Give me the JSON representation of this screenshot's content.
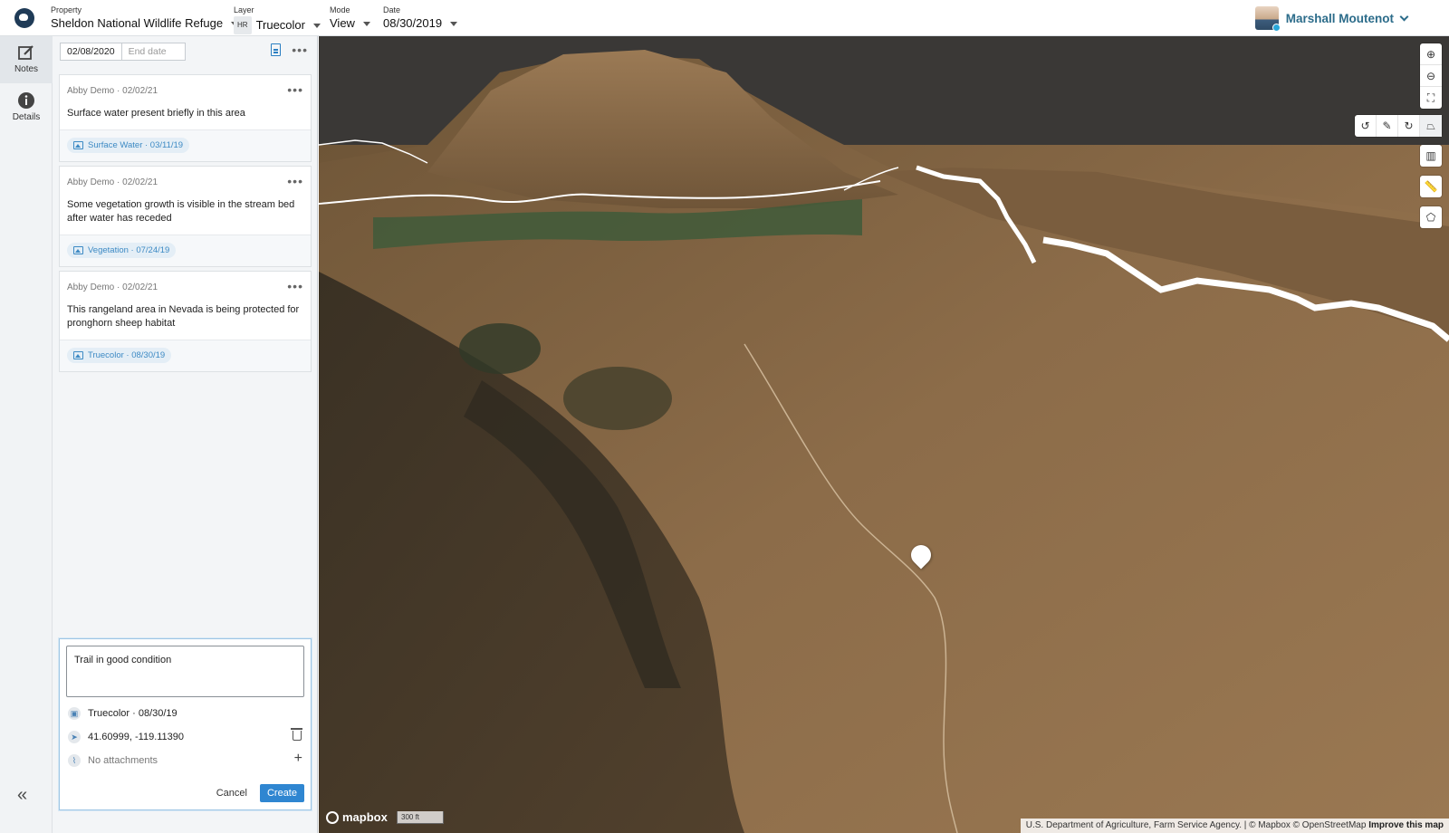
{
  "topbar": {
    "property": {
      "label": "Property",
      "value": "Sheldon National Wildlife Refuge"
    },
    "layer": {
      "label": "Layer",
      "badge": "HR",
      "value": "Truecolor"
    },
    "mode": {
      "label": "Mode",
      "value": "View"
    },
    "date": {
      "label": "Date",
      "value": "08/30/2019"
    },
    "user": {
      "name": "Marshall Moutenot"
    }
  },
  "rail": {
    "items": [
      {
        "label": "Notes",
        "icon": "edit-icon"
      },
      {
        "label": "Details",
        "icon": "info-icon"
      }
    ],
    "collapse_glyph": "«"
  },
  "panel": {
    "start_date": "02/08/2020",
    "end_date_placeholder": "End date",
    "notes": [
      {
        "author_date": "Abby Demo · 02/02/21",
        "text": "Surface water present briefly in this area",
        "tag": "Surface Water · 03/11/19"
      },
      {
        "author_date": "Abby Demo · 02/02/21",
        "text": "Some vegetation growth is visible in the stream bed after water has receded",
        "tag": "Vegetation · 07/24/19"
      },
      {
        "author_date": "Abby Demo · 02/02/21",
        "text": "This rangeland area in Nevada is being protected for pronghorn sheep habitat",
        "tag": "Truecolor · 08/30/19"
      }
    ],
    "composer": {
      "text": "Trail in good condition",
      "layer": "Truecolor · 08/30/19",
      "coords": "41.60999, -119.11390",
      "attachments": "No attachments",
      "cancel_label": "Cancel",
      "create_label": "Create"
    }
  },
  "map": {
    "logo_text": "mapbox",
    "scale_label": "300 ft",
    "attribution": "U.S. Department of Agriculture, Farm Service Agency. | © Mapbox © OpenStreetMap",
    "improve_label": "Improve this map",
    "colors": {
      "terrain": "#8a6a48",
      "sky": "#3b3b3b",
      "water": "#3f5a3a",
      "boundary": "#ffffff"
    }
  }
}
